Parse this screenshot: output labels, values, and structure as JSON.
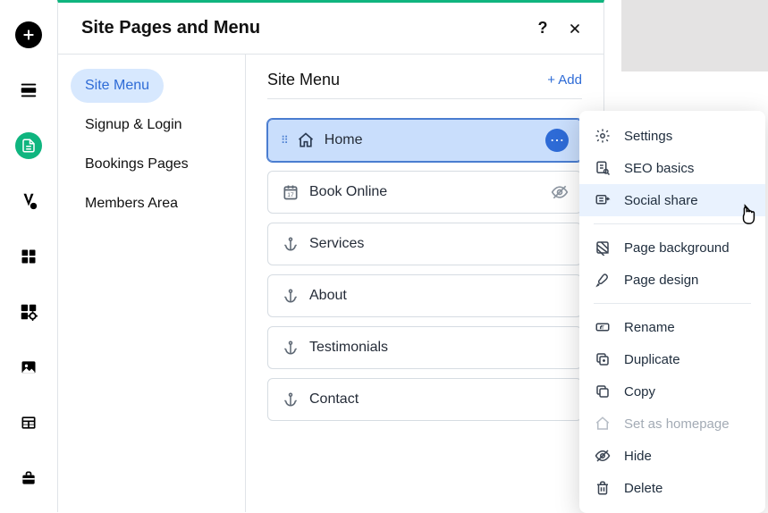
{
  "panel_title": "Site Pages and Menu",
  "sidebar": {
    "items": [
      {
        "label": "Site Menu",
        "active": true
      },
      {
        "label": "Signup & Login"
      },
      {
        "label": "Bookings Pages"
      },
      {
        "label": "Members Area"
      }
    ]
  },
  "main": {
    "heading": "Site Menu",
    "add_label": "+  Add",
    "pages": [
      {
        "label": "Home",
        "icon": "home",
        "selected": true
      },
      {
        "label": "Book Online",
        "icon": "calendar",
        "hidden": true
      },
      {
        "label": "Services",
        "icon": "anchor"
      },
      {
        "label": "About",
        "icon": "anchor"
      },
      {
        "label": "Testimonials",
        "icon": "anchor"
      },
      {
        "label": "Contact",
        "icon": "anchor"
      }
    ]
  },
  "context_menu": {
    "groups": [
      [
        {
          "label": "Settings",
          "icon": "gear"
        },
        {
          "label": "SEO basics",
          "icon": "search-doc"
        },
        {
          "label": "Social share",
          "icon": "social",
          "hover": true
        }
      ],
      [
        {
          "label": "Page background",
          "icon": "background"
        },
        {
          "label": "Page design",
          "icon": "brush"
        }
      ],
      [
        {
          "label": "Rename",
          "icon": "rename"
        },
        {
          "label": "Duplicate",
          "icon": "duplicate"
        },
        {
          "label": "Copy",
          "icon": "copy"
        },
        {
          "label": "Set as homepage",
          "icon": "home-outline",
          "disabled": true
        },
        {
          "label": "Hide",
          "icon": "hide"
        },
        {
          "label": "Delete",
          "icon": "delete"
        }
      ]
    ]
  }
}
